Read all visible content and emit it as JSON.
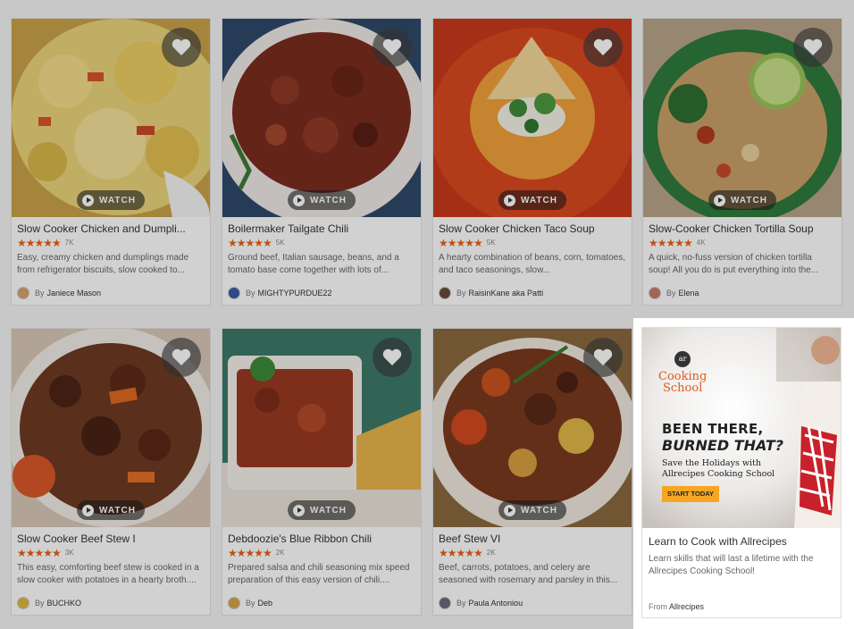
{
  "colors": {
    "star": "#e8611a",
    "ad_button": "#f5a623",
    "logo": "#e05a1c"
  },
  "cards": [
    {
      "title": "Slow Cooker Chicken and Dumpli...",
      "stars": "★★★★★",
      "count": "7K",
      "watch": "WATCH",
      "desc": "Easy, creamy chicken and dumplings made from refrigerator biscuits, slow cooked to...",
      "by": "By",
      "author": "Janiece Mason"
    },
    {
      "title": "Boilermaker Tailgate Chili",
      "stars": "★★★★★",
      "count": "5K",
      "watch": "WATCH",
      "desc": "Ground beef, Italian sausage, beans, and a tomato base come together with lots of...",
      "by": "By",
      "author": "MIGHTYPURDUE22"
    },
    {
      "title": "Slow Cooker Chicken Taco Soup",
      "stars": "★★★★★",
      "count": "5K",
      "watch": "WATCH",
      "desc": "A hearty combination of beans, corn, tomatoes, and taco seasonings, slow...",
      "by": "By",
      "author": "RaisinKane aka Patti"
    },
    {
      "title": "Slow-Cooker Chicken Tortilla Soup",
      "stars": "★★★★★",
      "count": "4K",
      "watch": "WATCH",
      "desc": "A quick, no-fuss version of chicken tortilla soup! All you do is put everything into the...",
      "by": "By",
      "author": "Elena"
    },
    {
      "title": "Slow Cooker Beef Stew I",
      "stars": "★★★★★",
      "count": "3K",
      "watch": "WATCH",
      "desc": "This easy, comforting beef stew is cooked in a slow cooker with potatoes in a hearty broth....",
      "by": "By",
      "author": "BUCHKO"
    },
    {
      "title": "Debdoozie's Blue Ribbon Chili",
      "stars": "★★★★★",
      "count": "2K",
      "watch": "WATCH",
      "desc": "Prepared salsa and chili seasoning mix speed preparation of this easy version of chili....",
      "by": "By",
      "author": "Deb"
    },
    {
      "title": "Beef Stew VI",
      "stars": "★★★★★",
      "count": "2K",
      "watch": "WATCH",
      "desc": "Beef, carrots, potatoes, and celery are seasoned with rosemary and parsley in this...",
      "by": "By",
      "author": "Paula Antoniou"
    }
  ],
  "ad": {
    "logo_mark": "ar",
    "logo_line1": "Cooking",
    "logo_line2": "School",
    "headline1": "BEEN THERE,",
    "headline2": "BURNED THAT?",
    "subline": "Save the Holidays with Allrecipes Cooking School",
    "button": "START TODAY",
    "title": "Learn to Cook with Allrecipes",
    "desc": "Learn skills that will last a lifetime with the Allrecipes Cooking School!",
    "from_label": "From",
    "from": "Allrecipes"
  }
}
